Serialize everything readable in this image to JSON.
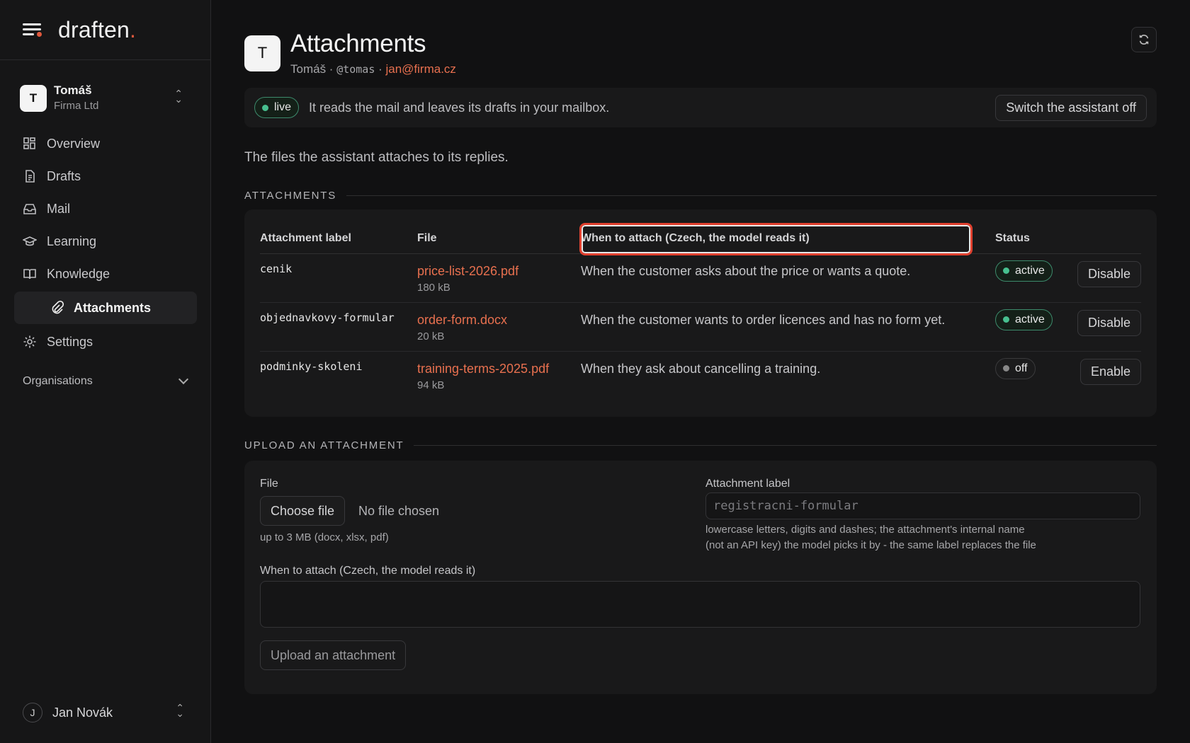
{
  "brand": {
    "name": "draften",
    "dot": "."
  },
  "workspace": {
    "initial": "T",
    "name": "Tomáš",
    "company": "Firma Ltd"
  },
  "nav": {
    "overview": "Overview",
    "drafts": "Drafts",
    "mail": "Mail",
    "learning": "Learning",
    "knowledge": "Knowledge",
    "attachments": "Attachments",
    "settings": "Settings"
  },
  "organisations_label": "Organisations",
  "user": {
    "initial": "J",
    "name": "Jan Novák"
  },
  "header": {
    "initial": "T",
    "title": "Attachments",
    "name": "Tomáš",
    "sep1": " · ",
    "handle": "@tomas",
    "sep2": " · ",
    "email": "jan@firma.cz"
  },
  "status": {
    "pill": "live",
    "text": "It reads the mail and leaves its drafts in your mailbox.",
    "switch_off": "Switch the assistant off"
  },
  "lead": "The files the assistant attaches to its replies.",
  "attachments_section": {
    "title": "ATTACHMENTS",
    "columns": [
      "Attachment label",
      "File",
      "When to attach (Czech, the model reads it)",
      "Status"
    ],
    "rows": [
      {
        "label": "cenik",
        "file": "price-list-2026.pdf",
        "size": "180 kB",
        "when": "When the customer asks about the price or wants a quote.",
        "status": "active",
        "action": "Disable"
      },
      {
        "label": "objednavkovy-formular",
        "file": "order-form.docx",
        "size": "20 kB",
        "when": "When the customer wants to order licences and has no form yet.",
        "status": "active",
        "action": "Disable"
      },
      {
        "label": "podminky-skoleni",
        "file": "training-terms-2025.pdf",
        "size": "94 kB",
        "when": "When they ask about cancelling a training.",
        "status": "off",
        "action": "Enable"
      }
    ]
  },
  "upload_section": {
    "title": "UPLOAD AN ATTACHMENT",
    "file_label": "File",
    "choose_file": "Choose file",
    "no_file": "No file chosen",
    "file_hint": "up to 3 MB (docx, xlsx, pdf)",
    "label_label": "Attachment label",
    "label_placeholder": "registracni-formular",
    "label_hint_1": "lowercase letters, digits and dashes; the attachment's internal name",
    "label_hint_2": "(not an API key) the model picks it by - the same label replaces the file",
    "when_label": "When to attach (Czech, the model reads it)",
    "when_value": "",
    "submit": "Upload an attachment"
  },
  "colors": {
    "accent": "#e8704f",
    "active_green": "#47c08f",
    "highlight": "#e0402e"
  }
}
